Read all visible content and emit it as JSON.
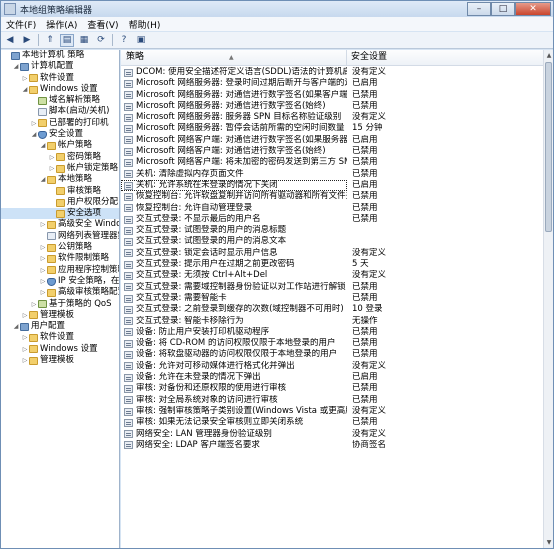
{
  "window": {
    "title": "本地组策略编辑器"
  },
  "menu": [
    "文件(F)",
    "操作(A)",
    "查看(V)",
    "帮助(H)"
  ],
  "tree": [
    {
      "label": "本地计算机 策略",
      "level": 0,
      "icon": "pc",
      "twisty": ""
    },
    {
      "label": "计算机配置",
      "level": 1,
      "icon": "pc",
      "twisty": "◢"
    },
    {
      "label": "软件设置",
      "level": 2,
      "icon": "folder",
      "twisty": "▷"
    },
    {
      "label": "Windows 设置",
      "level": 2,
      "icon": "folder",
      "twisty": "◢"
    },
    {
      "label": "域名解析策略",
      "level": 3,
      "icon": "chart",
      "twisty": ""
    },
    {
      "label": "脚本(启动/关机)",
      "level": 3,
      "icon": "doc",
      "twisty": ""
    },
    {
      "label": "已部署的打印机",
      "level": 3,
      "icon": "folder",
      "twisty": "▷"
    },
    {
      "label": "安全设置",
      "level": 3,
      "icon": "shield",
      "twisty": "◢"
    },
    {
      "label": "帐户策略",
      "level": 4,
      "icon": "folder",
      "twisty": "◢"
    },
    {
      "label": "密码策略",
      "level": 5,
      "icon": "folder",
      "twisty": "▷"
    },
    {
      "label": "帐户锁定策略",
      "level": 5,
      "icon": "folder",
      "twisty": "▷"
    },
    {
      "label": "本地策略",
      "level": 4,
      "icon": "folder",
      "twisty": "◢"
    },
    {
      "label": "审核策略",
      "level": 5,
      "icon": "folder",
      "twisty": ""
    },
    {
      "label": "用户权限分配",
      "level": 5,
      "icon": "folder",
      "twisty": ""
    },
    {
      "label": "安全选项",
      "level": 5,
      "icon": "folder",
      "twisty": "",
      "selected": true
    },
    {
      "label": "高级安全 Windows",
      "level": 4,
      "icon": "folder",
      "twisty": "▷"
    },
    {
      "label": "网络列表管理器策略",
      "level": 4,
      "icon": "doc",
      "twisty": ""
    },
    {
      "label": "公钥策略",
      "level": 4,
      "icon": "folder",
      "twisty": "▷"
    },
    {
      "label": "软件限制策略",
      "level": 4,
      "icon": "folder",
      "twisty": "▷"
    },
    {
      "label": "应用程序控制策略",
      "level": 4,
      "icon": "folder",
      "twisty": "▷"
    },
    {
      "label": "IP 安全策略，在",
      "level": 4,
      "icon": "shield",
      "twisty": "▷"
    },
    {
      "label": "高级审核策略配置",
      "level": 4,
      "icon": "folder",
      "twisty": "▷"
    },
    {
      "label": "基于策略的 QoS",
      "level": 3,
      "icon": "chart",
      "twisty": "▷"
    },
    {
      "label": "管理模板",
      "level": 2,
      "icon": "folder",
      "twisty": "▷"
    },
    {
      "label": "用户配置",
      "level": 1,
      "icon": "pc",
      "twisty": "◢"
    },
    {
      "label": "软件设置",
      "level": 2,
      "icon": "folder",
      "twisty": "▷"
    },
    {
      "label": "Windows 设置",
      "level": 2,
      "icon": "folder",
      "twisty": "▷"
    },
    {
      "label": "管理模板",
      "level": 2,
      "icon": "folder",
      "twisty": "▷"
    }
  ],
  "columns": {
    "policy": "策略",
    "setting": "安全设置"
  },
  "policies": [
    {
      "name": "DCOM: 使用安全描述符定义语言(SDDL)语法的计算机启动...",
      "value": "没有定义"
    },
    {
      "name": "Microsoft 网络服务器: 登录时间过期后断开与客户端的连接",
      "value": "已启用"
    },
    {
      "name": "Microsoft 网络服务器: 对通信进行数字签名(如果客户端允...",
      "value": "已禁用"
    },
    {
      "name": "Microsoft 网络服务器: 对通信进行数字签名(始终)",
      "value": "已禁用"
    },
    {
      "name": "Microsoft 网络服务器: 服务器 SPN 目标名称验证级别",
      "value": "没有定义"
    },
    {
      "name": "Microsoft 网络服务器: 暂停会话前所需的空闲时间数量",
      "value": "15 分钟"
    },
    {
      "name": "Microsoft 网络客户端: 对通信进行数字签名(如果服务器允...",
      "value": "已启用"
    },
    {
      "name": "Microsoft 网络客户端: 对通信进行数字签名(始终)",
      "value": "已禁用"
    },
    {
      "name": "Microsoft 网络客户端: 将未加密的密码发送到第三方 SMB...",
      "value": "已禁用"
    },
    {
      "name": "关机: 清除虚拟内存页面文件",
      "value": "已禁用"
    },
    {
      "name": "关机: 允许系统在未登录的情况下关闭",
      "value": "已启用",
      "focus": true
    },
    {
      "name": "恢复控制台: 允许软盘复制并访问所有驱动器和所有文件夹",
      "value": "已禁用"
    },
    {
      "name": "恢复控制台: 允许自动管理登录",
      "value": "已禁用"
    },
    {
      "name": "交互式登录: 不显示最后的用户名",
      "value": "已禁用"
    },
    {
      "name": "交互式登录: 试图登录的用户的消息标题",
      "value": ""
    },
    {
      "name": "交互式登录: 试图登录的用户的消息文本",
      "value": ""
    },
    {
      "name": "交互式登录: 锁定会话时显示用户信息",
      "value": "没有定义"
    },
    {
      "name": "交互式登录: 提示用户在过期之前更改密码",
      "value": "5 天"
    },
    {
      "name": "交互式登录: 无须按 Ctrl+Alt+Del",
      "value": "没有定义"
    },
    {
      "name": "交互式登录: 需要域控制器身份验证以对工作站进行解锁",
      "value": "已禁用"
    },
    {
      "name": "交互式登录: 需要智能卡",
      "value": "已禁用"
    },
    {
      "name": "交互式登录: 之前登录到缓存的次数(域控制器不可用时)",
      "value": "10 登录"
    },
    {
      "name": "交互式登录: 智能卡移除行为",
      "value": "无操作"
    },
    {
      "name": "设备: 防止用户安装打印机驱动程序",
      "value": "已禁用"
    },
    {
      "name": "设备: 将 CD-ROM 的访问权限仅限于本地登录的用户",
      "value": "已禁用"
    },
    {
      "name": "设备: 将软盘驱动器的访问权限仅限于本地登录的用户",
      "value": "已禁用"
    },
    {
      "name": "设备: 允许对可移动媒体进行格式化并弹出",
      "value": "没有定义"
    },
    {
      "name": "设备: 允许在未登录的情况下弹出",
      "value": "已启用"
    },
    {
      "name": "审核: 对备份和还原权限的使用进行审核",
      "value": "已禁用"
    },
    {
      "name": "审核: 对全局系统对象的访问进行审核",
      "value": "已禁用"
    },
    {
      "name": "审核: 强制审核策略子类别设置(Windows Vista 或更高版本...",
      "value": "没有定义"
    },
    {
      "name": "审核: 如果无法记录安全审核则立即关闭系统",
      "value": "已禁用"
    },
    {
      "name": "网络安全: LAN 管理器身份验证级别",
      "value": "没有定义"
    },
    {
      "name": "网络安全: LDAP 客户端签名要求",
      "value": "协商签名"
    }
  ]
}
